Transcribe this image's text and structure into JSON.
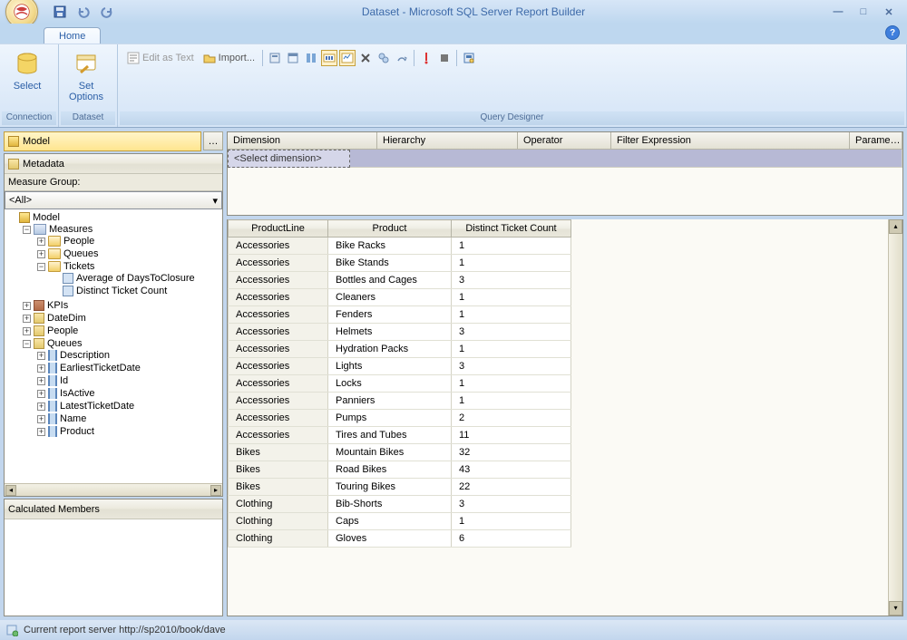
{
  "window": {
    "title": "Dataset - Microsoft SQL Server Report Builder"
  },
  "tabs": {
    "home": "Home"
  },
  "ribbon": {
    "connection_group": "Connection",
    "dataset_group": "Dataset",
    "qd_group": "Query Designer",
    "select": "Select",
    "set_options": "Set\nOptions",
    "edit_as_text": "Edit as Text",
    "import": "Import..."
  },
  "left": {
    "model": "Model",
    "metadata": "Metadata",
    "measure_group_label": "Measure Group:",
    "measure_group_all": "<All>",
    "calc_members": "Calculated Members",
    "tree": {
      "root": "Model",
      "measures": "Measures",
      "folders": {
        "people": "People",
        "queues": "Queues",
        "tickets": "Tickets"
      },
      "measure_items": {
        "avg_days": "Average of DaysToClosure",
        "distinct": "Distinct Ticket Count"
      },
      "kpis": "KPIs",
      "datedim": "DateDim",
      "people": "People",
      "queues": "Queues",
      "attrs": {
        "desc": "Description",
        "earliest": "EarliestTicketDate",
        "id": "Id",
        "isactive": "IsActive",
        "latest": "LatestTicketDate",
        "name": "Name",
        "product": "Product"
      }
    }
  },
  "filter": {
    "h_dimension": "Dimension",
    "h_hierarchy": "Hierarchy",
    "h_operator": "Operator",
    "h_filterexp": "Filter Expression",
    "h_param": "Parame…",
    "select_dim": "<Select dimension>"
  },
  "results": {
    "headers": {
      "pl": "ProductLine",
      "p": "Product",
      "d": "Distinct Ticket Count"
    },
    "rows": [
      {
        "pl": "Accessories",
        "p": "Bike Racks",
        "d": "1"
      },
      {
        "pl": "Accessories",
        "p": "Bike Stands",
        "d": "1"
      },
      {
        "pl": "Accessories",
        "p": "Bottles and Cages",
        "d": "3"
      },
      {
        "pl": "Accessories",
        "p": "Cleaners",
        "d": "1"
      },
      {
        "pl": "Accessories",
        "p": "Fenders",
        "d": "1"
      },
      {
        "pl": "Accessories",
        "p": "Helmets",
        "d": "3"
      },
      {
        "pl": "Accessories",
        "p": "Hydration Packs",
        "d": "1"
      },
      {
        "pl": "Accessories",
        "p": "Lights",
        "d": "3"
      },
      {
        "pl": "Accessories",
        "p": "Locks",
        "d": "1"
      },
      {
        "pl": "Accessories",
        "p": "Panniers",
        "d": "1"
      },
      {
        "pl": "Accessories",
        "p": "Pumps",
        "d": "2"
      },
      {
        "pl": "Accessories",
        "p": "Tires and Tubes",
        "d": "11"
      },
      {
        "pl": "Bikes",
        "p": "Mountain Bikes",
        "d": "32"
      },
      {
        "pl": "Bikes",
        "p": "Road Bikes",
        "d": "43"
      },
      {
        "pl": "Bikes",
        "p": "Touring Bikes",
        "d": "22"
      },
      {
        "pl": "Clothing",
        "p": "Bib-Shorts",
        "d": "3"
      },
      {
        "pl": "Clothing",
        "p": "Caps",
        "d": "1"
      },
      {
        "pl": "Clothing",
        "p": "Gloves",
        "d": "6"
      }
    ]
  },
  "status": {
    "text": "Current report server http://sp2010/book/dave"
  }
}
